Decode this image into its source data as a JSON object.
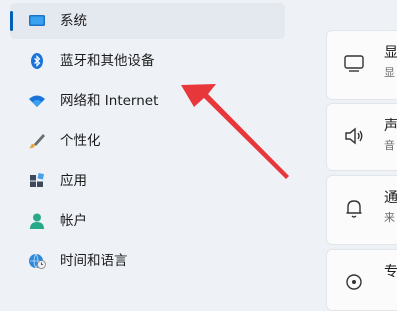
{
  "nav": {
    "items": [
      {
        "label": "系统",
        "icon": "system-icon"
      },
      {
        "label": "蓝牙和其他设备",
        "icon": "bluetooth-icon"
      },
      {
        "label": "网络和 Internet",
        "icon": "wifi-icon"
      },
      {
        "label": "个性化",
        "icon": "brush-icon"
      },
      {
        "label": "应用",
        "icon": "apps-icon"
      },
      {
        "label": "帐户",
        "icon": "account-icon"
      },
      {
        "label": "时间和语言",
        "icon": "globe-clock-icon"
      }
    ]
  },
  "cards": [
    {
      "title": "显",
      "sub": "显",
      "icon": "display-icon"
    },
    {
      "title": "声",
      "sub": "音",
      "icon": "sound-icon"
    },
    {
      "title": "通",
      "sub": "来",
      "icon": "bell-icon"
    },
    {
      "title": "专",
      "sub": "",
      "icon": "focus-icon"
    }
  ],
  "colors": {
    "accent": "#005fb8",
    "arrow": "#e8373a"
  }
}
